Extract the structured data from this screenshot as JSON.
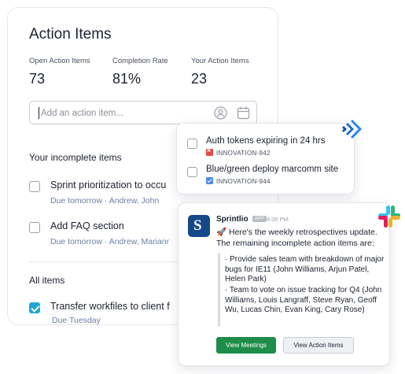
{
  "main": {
    "title": "Action Items",
    "stats": [
      {
        "label": "Open Action Items",
        "value": "73"
      },
      {
        "label": "Completion Rate",
        "value": "81%"
      },
      {
        "label": "Your Action Items",
        "value": "23"
      }
    ],
    "add_input": {
      "placeholder": "Add an action item...",
      "value": ""
    },
    "incomplete_heading": "Your incomplete items",
    "incomplete_items": [
      {
        "text": "Sprint prioritization to occu",
        "meta": "Due tomorrow · Andrew, John",
        "checked": false
      },
      {
        "text": "Add FAQ section",
        "meta": "Due tomorrow · Andrew, Marianr",
        "checked": false
      }
    ],
    "all_heading": "All items",
    "all_items": [
      {
        "text": "Transfer workfiles to client f",
        "meta": "Due Tuesday",
        "checked": true
      }
    ]
  },
  "jira": {
    "icon": "jira-logo-icon",
    "items": [
      {
        "text": "Auth tokens expiring in 24 hrs",
        "key": "INNOVATION-942",
        "badge": "red",
        "checked": false
      },
      {
        "text": "Blue/green deploy marcomm site",
        "key": "INNOVATION-944",
        "badge": "blue",
        "checked": false
      }
    ]
  },
  "slack": {
    "icon": "slack-logo-icon",
    "app_name": "Sprintlio",
    "app_tag": "APP",
    "time": "4:00 PM",
    "intro": "🚀 Here's the weekly retrospectives update. The remaining incomplete action items are:",
    "quote_items": [
      "· Provide sales team with breakdown of major bugs for IE11 (John Williams, Arjun Patel, Helen Park)",
      "· Team to vote on issue tracking for Q4 (John Williams, Louis Langraff, Steve Ryan, Geoff Wu, Lucas Chin, Evan King, Cary Rose)"
    ],
    "buttons": {
      "primary": "View Meetings",
      "secondary": "View Action Items"
    }
  },
  "colors": {
    "accent": "#1fa7d6",
    "primary_button": "#1e8d4a",
    "meta_text": "#6b7fa6"
  }
}
